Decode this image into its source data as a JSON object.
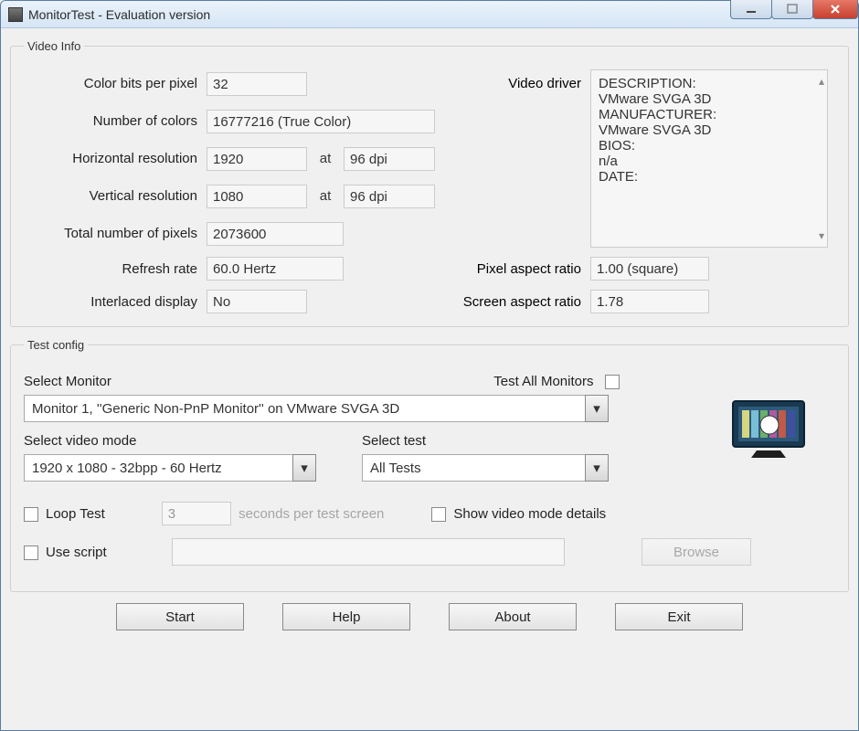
{
  "window": {
    "title": "MonitorTest - Evaluation version"
  },
  "groups": {
    "video_info": "Video Info",
    "test_config": "Test config"
  },
  "video": {
    "labels": {
      "color_bits": "Color bits per pixel",
      "num_colors": "Number of colors",
      "h_res": "Horizontal resolution",
      "v_res": "Vertical resolution",
      "total_pixels": "Total number of pixels",
      "refresh": "Refresh rate",
      "interlaced": "Interlaced display",
      "video_driver": "Video driver",
      "pixel_ar": "Pixel aspect ratio",
      "screen_ar": "Screen aspect ratio",
      "at": "at"
    },
    "color_bits": "32",
    "num_colors": "16777216 (True Color)",
    "h_res_val": "1920",
    "h_res_dpi": "96 dpi",
    "v_res_val": "1080",
    "v_res_dpi": "96 dpi",
    "total_pixels": "2073600",
    "refresh": "60.0 Hertz",
    "interlaced": "No",
    "pixel_ar": "1.00 (square)",
    "screen_ar": "1.78",
    "driver_text": "DESCRIPTION:\nVMware SVGA 3D\nMANUFACTURER:\nVMware SVGA 3D\nBIOS:\nn/a\nDATE:"
  },
  "config": {
    "labels": {
      "select_monitor": "Select Monitor",
      "test_all": "Test All Monitors",
      "select_mode": "Select video mode",
      "select_test": "Select test",
      "loop": "Loop Test",
      "secs_per": "seconds per test screen",
      "show_details": "Show video mode details",
      "use_script": "Use script",
      "browse": "Browse"
    },
    "monitor_value": "Monitor 1, ''Generic Non-PnP Monitor'' on VMware SVGA 3D",
    "mode_value": "1920 x 1080 - 32bpp - 60 Hertz",
    "test_value": "All Tests",
    "secs_value": "3",
    "script_path": ""
  },
  "buttons": {
    "start": "Start",
    "help": "Help",
    "about": "About",
    "exit": "Exit"
  },
  "glyphs": {
    "tri_down": "▾",
    "tri_up": "▴"
  }
}
